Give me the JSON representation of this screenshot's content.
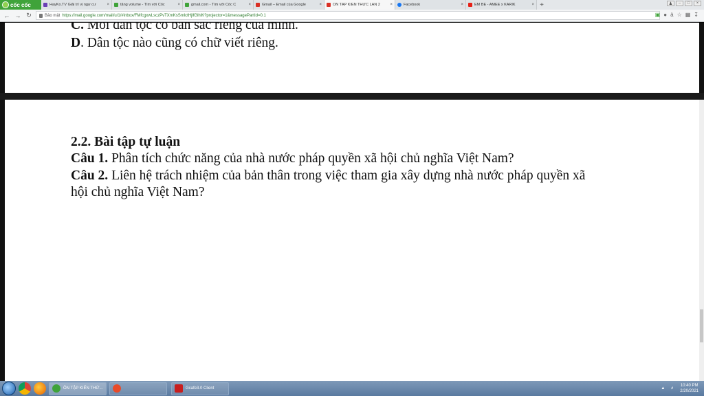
{
  "browser": {
    "brand": "cốc cốc",
    "tabs": [
      {
        "label": "HayKo.TV Giải trí vị ngư cư",
        "close": "×",
        "color": "#6a3fb5"
      },
      {
        "label": "tăng volume - Tìm với Cốc",
        "close": "×",
        "color": "#3fa33a"
      },
      {
        "label": "gmail.com - Tìm với Cốc C",
        "close": "×",
        "color": "#3fa33a"
      },
      {
        "label": "Gmail – Email của Google",
        "close": "×",
        "color": "#d93025"
      },
      {
        "label": "ÔN TẬP KIẾN THỨC LẦN 2",
        "close": "×",
        "color": "#d93025"
      },
      {
        "label": "Facebook",
        "close": "×",
        "color": "#1877f2"
      },
      {
        "label": "EM BÉ - AMEE x KARIK",
        "close": "×",
        "color": "#e62117"
      }
    ],
    "new_tab": "+",
    "insecure_label": "Bảo mật",
    "url": "https://mail.google.com/mail/u/1/#inbox/FMfcgxwLsczPvTXmKsSmlctHjlfGlhlK?projector=1&messagePartId=0.1"
  },
  "document": {
    "page1": {
      "line_c": {
        "letter": "C.",
        "text": " Mỗi dân tộc có bản sắc riêng của mình."
      },
      "line_d": {
        "letter": "D",
        "text": ". Dân tộc nào cũng có chữ viết riêng."
      }
    },
    "page2": {
      "heading": "2.2. Bài tập tự luận",
      "q1": {
        "label": "Câu 1.",
        "text": " Phân tích chức năng của nhà nước pháp quyền xã hội chủ nghĩa Việt Nam?"
      },
      "q2": {
        "label": "Câu 2.",
        "text": " Liên hệ trách nhiệm của bản thân trong việc tham gia xây dựng nhà nước pháp quyền xã"
      },
      "q2_cont": "hội chủ nghĩa Việt Nam?"
    }
  },
  "taskbar": {
    "tasks": [
      {
        "label": "ÔN TẬP KIẾN THỨ..."
      },
      {
        "label": ""
      },
      {
        "label": "Gcafe3.0 Client"
      }
    ],
    "clock_time": "10:40 PM",
    "clock_date": "2/20/2021"
  }
}
